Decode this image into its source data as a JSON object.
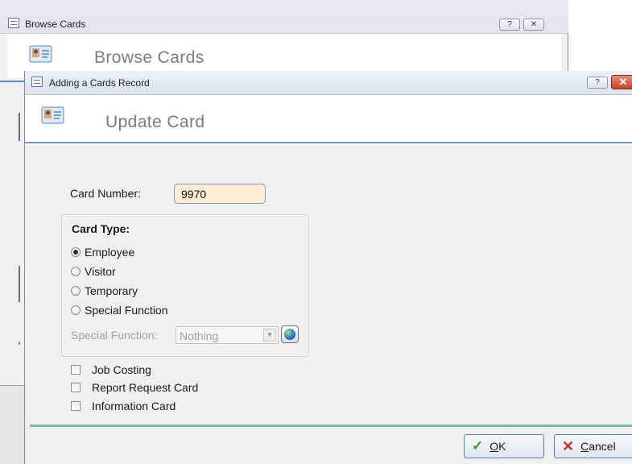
{
  "background_window": {
    "title": "Browse Cards",
    "header_title": "Browse Cards",
    "help_button": "?",
    "close_button": "✕"
  },
  "dialog": {
    "title": "Adding a Cards Record",
    "header_title": "Update Card",
    "help_button": "?",
    "close_button": "✕",
    "card_number_label": "Card Number:",
    "card_number_value": "9970",
    "card_type_title": "Card Type:",
    "card_types": [
      "Employee",
      "Visitor",
      "Temporary",
      "Special Function"
    ],
    "selected_card_type": "Employee",
    "special_function_label": "Special Function:",
    "special_function_value": "Nothing",
    "checkboxes": [
      {
        "label": "Job Costing",
        "checked": false
      },
      {
        "label": "Report Request Card",
        "checked": false
      },
      {
        "label": "Information Card",
        "checked": false
      }
    ],
    "ok_label": "OK",
    "cancel_label": "Cancel"
  },
  "colors": {
    "input_background": "#fdeed3",
    "footer_line": "#79bda0",
    "header_rule": "#6d9bd1"
  },
  "icons": {
    "window_system": "menu-lines-icon",
    "card": "contact-card-icon",
    "globe": "globe-icon",
    "ok": "checkmark-icon",
    "cancel": "x-icon"
  }
}
